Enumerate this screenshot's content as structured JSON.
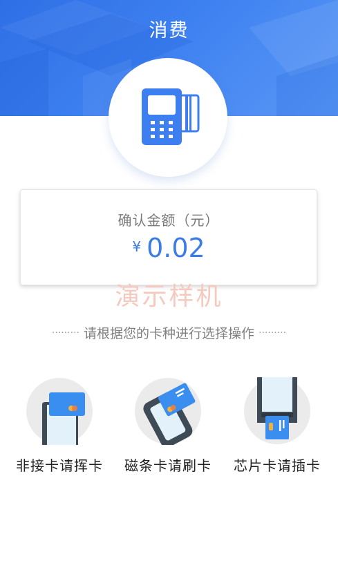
{
  "header": {
    "title": "消费",
    "terminal_icon": "pos-terminal-icon",
    "colors": {
      "gradient_start": "#2f6fe6",
      "gradient_end": "#5a98f6"
    }
  },
  "amount": {
    "label": "确认金额（元）",
    "currency_symbol": "¥",
    "value": "0.02",
    "color": "#3b7bea"
  },
  "watermark": "演示样机",
  "prompt": {
    "leading_dots": "·········",
    "text": "请根据您的卡种进行选择操作",
    "trailing_dots": "·········"
  },
  "payment_methods": [
    {
      "icon": "contactless-card-icon",
      "label": "非接卡请挥卡"
    },
    {
      "icon": "swipe-card-icon",
      "label": "磁条卡请刷卡"
    },
    {
      "icon": "chip-card-insert-icon",
      "label": "芯片卡请插卡"
    }
  ]
}
